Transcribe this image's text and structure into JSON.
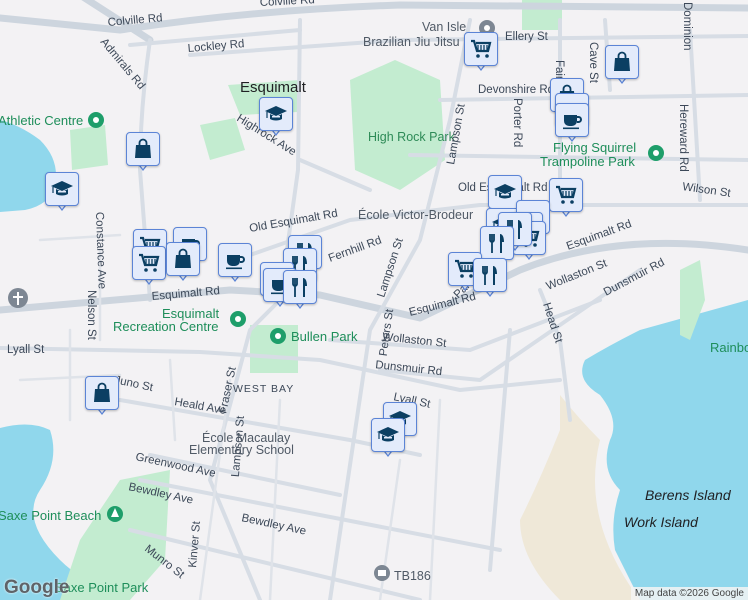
{
  "map": {
    "place_title": "Esquimalt",
    "streets": {
      "colville_rd": "Colville Rd",
      "colville_rd_2": "Colville Rd",
      "lockley_rd": "Lockley Rd",
      "admirals_rd": "Admirals Rd",
      "highrock_ave": "Highrock Ave",
      "old_esquimalt_rd": "Old Esquimalt Rd",
      "old_esquimalt_rd_2": "Old Esquimalt Rd",
      "fernhill_rd": "Fernhill Rd",
      "lampson_st": "Lampson St",
      "lampson_st_2": "Lampson St",
      "lampson_st_3": "Lampson St",
      "esquimalt_rd_w": "Esquimalt Rd",
      "esquimalt_rd_c": "Esquimalt Rd",
      "esquimalt_rd_e": "Esquimalt Rd",
      "ellery_st": "Ellery St",
      "devonshire_rd": "Devonshire Rd",
      "porter_rd": "Porter Rd",
      "fairview": "Fairview",
      "cave_st": "Cave St",
      "hereward_rd": "Hereward Rd",
      "dominion": "Dominion",
      "wilson_st": "Wilson St",
      "wollaston_st": "Wollaston St",
      "wollaston_st_2": "Wollaston St",
      "dunsmuir_rd": "Dunsmuir Rd",
      "dunsmuir_rd_2": "Dunsmuir Rd",
      "head_st": "Head St",
      "constance_ave": "Constance Ave",
      "nelson_st": "Nelson St",
      "lyall_st": "Lyall St",
      "lyall_st_2": "Lyall St",
      "juno_st": "Juno St",
      "fraser_st": "Fraser St",
      "heald_ave": "Heald Ave",
      "greenwood_ave": "Greenwood Ave",
      "bewdley_ave": "Bewdley Ave",
      "bewdley_ave_2": "Bewdley Ave",
      "kinver_st": "Kinver St",
      "munro_st": "Munro St",
      "paradise_st": "Paradise St",
      "peters_st": "Peters St"
    },
    "places": {
      "high_rock_park": "High Rock Park",
      "athletic_centre": "Athletic Centre",
      "ecole_victor_brodeur": "École Victor-Brodeur",
      "van_isle_bjj_1": "Van Isle",
      "van_isle_bjj_2": "Brazilian Jiu Jitsu",
      "flying_squirrel_1": "Flying Squirrel",
      "flying_squirrel_2": "Trampoline Park",
      "esquimalt_rec_1": "Esquimalt",
      "esquimalt_rec_2": "Recreation Centre",
      "bullen_park": "Bullen Park",
      "west_bay": "WEST BAY",
      "ecole_macaulay_1": "École Macaulay",
      "ecole_macaulay_2": "Elementary School",
      "saxe_point_beach": "Saxe Point Beach",
      "saxe_point_park": "Saxe Point Park",
      "tb186": "TB186",
      "berens_island": "Berens Island",
      "work_island": "Work Island",
      "rainbow": "Rainbow"
    },
    "markers": [
      "cart",
      "bag",
      "bag",
      "cup",
      "cup",
      "school",
      "bag",
      "school",
      "school",
      "cart",
      "school",
      "cup",
      "cup",
      "cart",
      "fork",
      "fork",
      "cart",
      "fork",
      "cart",
      "cup",
      "cart",
      "bag",
      "cup",
      "fork",
      "fork",
      "cup",
      "cup",
      "fork",
      "bag",
      "school",
      "school"
    ],
    "colors": {
      "water": "#90d7ec",
      "park": "#c3ecd0",
      "marker_fill": "#e3ebfb",
      "marker_border": "#5b84d6",
      "icon": "#0b3f63",
      "poi_green": "#1e9e6a"
    }
  },
  "footer": {
    "google_logo": "Google",
    "attribution": "Map data ©2026 Google"
  }
}
